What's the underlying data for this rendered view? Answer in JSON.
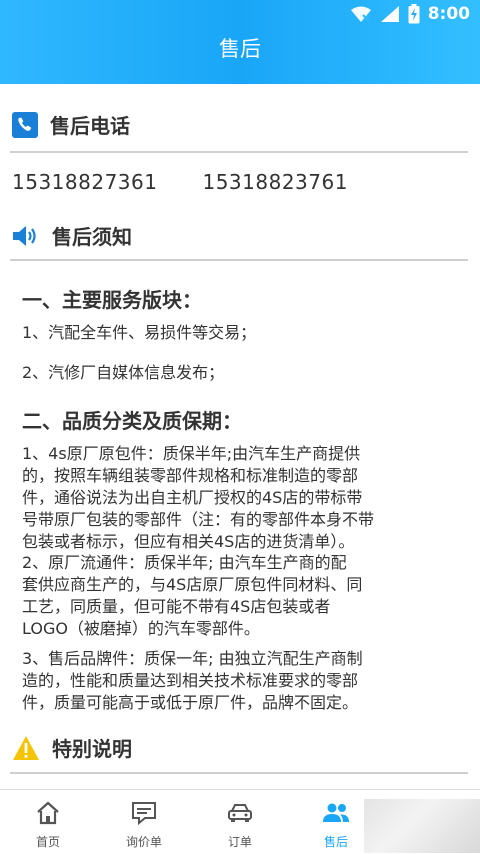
{
  "status": {
    "time": "8:00"
  },
  "header": {
    "title": "售后"
  },
  "sections": {
    "phone": {
      "title": "售后电话",
      "numbers": [
        "15318827361",
        "15318823761"
      ]
    },
    "notice": {
      "title": "售后须知"
    },
    "special": {
      "title": "特别说明"
    }
  },
  "content": {
    "h1": "一、主要服务版块：",
    "item1": "1、汽配全车件、易损件等交易；",
    "item2": "2、汽修厂自媒体信息发布；",
    "h2": "二、品质分类及质保期：",
    "para1": [
      "1、4s原厂原包件：质保半年;由汽车生产商提供",
      "的，按照车辆组装零部件规格和标准制造的零部",
      "件，通俗说法为出自主机厂授权的4S店的带标带",
      "号带原厂包装的零部件（注：有的零部件本身不带",
      "包装或者标示，但应有相关4S店的进货清单）。"
    ],
    "para2": [
      "2、原厂流通件：质保半年; 由汽车生产商的配",
      "套供应商生产的，与4S店原厂原包件同材料、同",
      "工艺，同质量，但可能不带有4S店包装或者",
      "LOGO（被磨掉）的汽车零部件。"
    ],
    "para3": [
      "3、售后品牌件：质保一年; 由独立汽配生产商制",
      "造的，性能和质量达到相关技术标准要求的零部",
      "件，质量可能高于或低于原厂件，品牌不固定。"
    ]
  },
  "tabs": [
    {
      "label": "首页",
      "icon": "home-icon"
    },
    {
      "label": "询价单",
      "icon": "message-icon"
    },
    {
      "label": "订单",
      "icon": "car-icon"
    },
    {
      "label": "售后",
      "icon": "people-icon"
    }
  ],
  "colors": {
    "brand": "#1aa6f7",
    "warning": "#f5c400"
  }
}
